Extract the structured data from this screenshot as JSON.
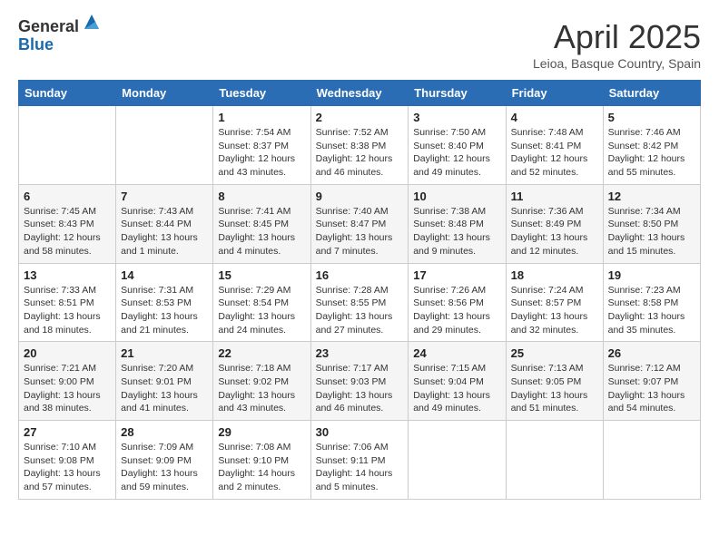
{
  "logo": {
    "general": "General",
    "blue": "Blue"
  },
  "title": "April 2025",
  "location": "Leioa, Basque Country, Spain",
  "days_of_week": [
    "Sunday",
    "Monday",
    "Tuesday",
    "Wednesday",
    "Thursday",
    "Friday",
    "Saturday"
  ],
  "weeks": [
    [
      {
        "day": "",
        "sunrise": "",
        "sunset": "",
        "daylight": ""
      },
      {
        "day": "",
        "sunrise": "",
        "sunset": "",
        "daylight": ""
      },
      {
        "day": "1",
        "sunrise": "Sunrise: 7:54 AM",
        "sunset": "Sunset: 8:37 PM",
        "daylight": "Daylight: 12 hours and 43 minutes."
      },
      {
        "day": "2",
        "sunrise": "Sunrise: 7:52 AM",
        "sunset": "Sunset: 8:38 PM",
        "daylight": "Daylight: 12 hours and 46 minutes."
      },
      {
        "day": "3",
        "sunrise": "Sunrise: 7:50 AM",
        "sunset": "Sunset: 8:40 PM",
        "daylight": "Daylight: 12 hours and 49 minutes."
      },
      {
        "day": "4",
        "sunrise": "Sunrise: 7:48 AM",
        "sunset": "Sunset: 8:41 PM",
        "daylight": "Daylight: 12 hours and 52 minutes."
      },
      {
        "day": "5",
        "sunrise": "Sunrise: 7:46 AM",
        "sunset": "Sunset: 8:42 PM",
        "daylight": "Daylight: 12 hours and 55 minutes."
      }
    ],
    [
      {
        "day": "6",
        "sunrise": "Sunrise: 7:45 AM",
        "sunset": "Sunset: 8:43 PM",
        "daylight": "Daylight: 12 hours and 58 minutes."
      },
      {
        "day": "7",
        "sunrise": "Sunrise: 7:43 AM",
        "sunset": "Sunset: 8:44 PM",
        "daylight": "Daylight: 13 hours and 1 minute."
      },
      {
        "day": "8",
        "sunrise": "Sunrise: 7:41 AM",
        "sunset": "Sunset: 8:45 PM",
        "daylight": "Daylight: 13 hours and 4 minutes."
      },
      {
        "day": "9",
        "sunrise": "Sunrise: 7:40 AM",
        "sunset": "Sunset: 8:47 PM",
        "daylight": "Daylight: 13 hours and 7 minutes."
      },
      {
        "day": "10",
        "sunrise": "Sunrise: 7:38 AM",
        "sunset": "Sunset: 8:48 PM",
        "daylight": "Daylight: 13 hours and 9 minutes."
      },
      {
        "day": "11",
        "sunrise": "Sunrise: 7:36 AM",
        "sunset": "Sunset: 8:49 PM",
        "daylight": "Daylight: 13 hours and 12 minutes."
      },
      {
        "day": "12",
        "sunrise": "Sunrise: 7:34 AM",
        "sunset": "Sunset: 8:50 PM",
        "daylight": "Daylight: 13 hours and 15 minutes."
      }
    ],
    [
      {
        "day": "13",
        "sunrise": "Sunrise: 7:33 AM",
        "sunset": "Sunset: 8:51 PM",
        "daylight": "Daylight: 13 hours and 18 minutes."
      },
      {
        "day": "14",
        "sunrise": "Sunrise: 7:31 AM",
        "sunset": "Sunset: 8:53 PM",
        "daylight": "Daylight: 13 hours and 21 minutes."
      },
      {
        "day": "15",
        "sunrise": "Sunrise: 7:29 AM",
        "sunset": "Sunset: 8:54 PM",
        "daylight": "Daylight: 13 hours and 24 minutes."
      },
      {
        "day": "16",
        "sunrise": "Sunrise: 7:28 AM",
        "sunset": "Sunset: 8:55 PM",
        "daylight": "Daylight: 13 hours and 27 minutes."
      },
      {
        "day": "17",
        "sunrise": "Sunrise: 7:26 AM",
        "sunset": "Sunset: 8:56 PM",
        "daylight": "Daylight: 13 hours and 29 minutes."
      },
      {
        "day": "18",
        "sunrise": "Sunrise: 7:24 AM",
        "sunset": "Sunset: 8:57 PM",
        "daylight": "Daylight: 13 hours and 32 minutes."
      },
      {
        "day": "19",
        "sunrise": "Sunrise: 7:23 AM",
        "sunset": "Sunset: 8:58 PM",
        "daylight": "Daylight: 13 hours and 35 minutes."
      }
    ],
    [
      {
        "day": "20",
        "sunrise": "Sunrise: 7:21 AM",
        "sunset": "Sunset: 9:00 PM",
        "daylight": "Daylight: 13 hours and 38 minutes."
      },
      {
        "day": "21",
        "sunrise": "Sunrise: 7:20 AM",
        "sunset": "Sunset: 9:01 PM",
        "daylight": "Daylight: 13 hours and 41 minutes."
      },
      {
        "day": "22",
        "sunrise": "Sunrise: 7:18 AM",
        "sunset": "Sunset: 9:02 PM",
        "daylight": "Daylight: 13 hours and 43 minutes."
      },
      {
        "day": "23",
        "sunrise": "Sunrise: 7:17 AM",
        "sunset": "Sunset: 9:03 PM",
        "daylight": "Daylight: 13 hours and 46 minutes."
      },
      {
        "day": "24",
        "sunrise": "Sunrise: 7:15 AM",
        "sunset": "Sunset: 9:04 PM",
        "daylight": "Daylight: 13 hours and 49 minutes."
      },
      {
        "day": "25",
        "sunrise": "Sunrise: 7:13 AM",
        "sunset": "Sunset: 9:05 PM",
        "daylight": "Daylight: 13 hours and 51 minutes."
      },
      {
        "day": "26",
        "sunrise": "Sunrise: 7:12 AM",
        "sunset": "Sunset: 9:07 PM",
        "daylight": "Daylight: 13 hours and 54 minutes."
      }
    ],
    [
      {
        "day": "27",
        "sunrise": "Sunrise: 7:10 AM",
        "sunset": "Sunset: 9:08 PM",
        "daylight": "Daylight: 13 hours and 57 minutes."
      },
      {
        "day": "28",
        "sunrise": "Sunrise: 7:09 AM",
        "sunset": "Sunset: 9:09 PM",
        "daylight": "Daylight: 13 hours and 59 minutes."
      },
      {
        "day": "29",
        "sunrise": "Sunrise: 7:08 AM",
        "sunset": "Sunset: 9:10 PM",
        "daylight": "Daylight: 14 hours and 2 minutes."
      },
      {
        "day": "30",
        "sunrise": "Sunrise: 7:06 AM",
        "sunset": "Sunset: 9:11 PM",
        "daylight": "Daylight: 14 hours and 5 minutes."
      },
      {
        "day": "",
        "sunrise": "",
        "sunset": "",
        "daylight": ""
      },
      {
        "day": "",
        "sunrise": "",
        "sunset": "",
        "daylight": ""
      },
      {
        "day": "",
        "sunrise": "",
        "sunset": "",
        "daylight": ""
      }
    ]
  ]
}
